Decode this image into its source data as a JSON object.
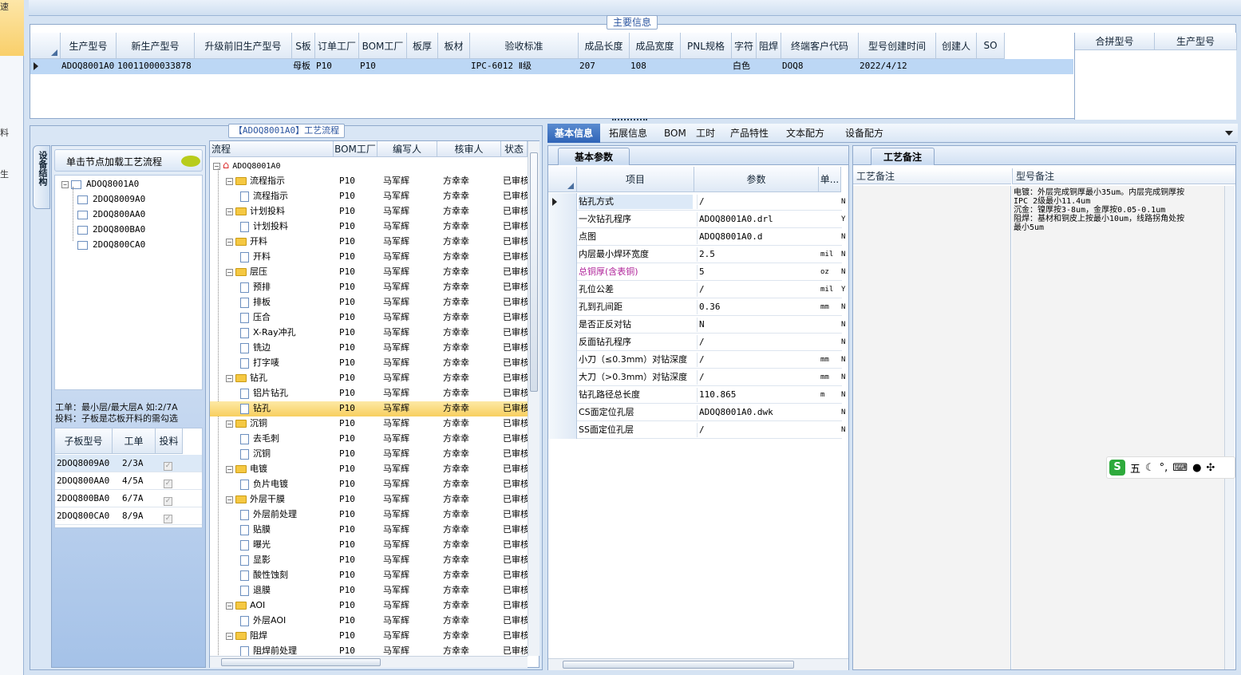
{
  "left_strip": {
    "items": [
      "速",
      "料",
      "生"
    ]
  },
  "main_info": {
    "caption": "主要信息",
    "columns": [
      "生产型号",
      "新生产型号",
      "升级前旧生产型号",
      "S板",
      "订单工厂",
      "BOM工厂",
      "板厚",
      "板材",
      "验收标准",
      "成品长度",
      "成品宽度",
      "PNL规格",
      "字符",
      "阻焊",
      "终端客户代码",
      "型号创建时间",
      "创建人",
      "SO"
    ],
    "row": [
      "ADOQ8001A0",
      "10011000033878",
      "",
      "母板",
      "P10",
      "P10",
      "",
      "",
      "IPC-6012 Ⅱ级",
      "207",
      "108",
      "",
      "白色",
      "",
      "DOQ8",
      "2022/4/12",
      "",
      ""
    ],
    "side_columns": [
      "合拼型号",
      "生产型号"
    ]
  },
  "process": {
    "caption": "【ADOQ8001A0】工艺流程",
    "vertical_tab": "设备结构",
    "load_button": "单击节点加载工艺流程",
    "struct_tree": {
      "root": "ADOQ8001A0",
      "children": [
        "2DOQ8009A0",
        "2DOQ800AA0",
        "2DOQ800BA0",
        "2DOQ800CA0"
      ]
    },
    "notes": [
      "工单：最小层/最大层A 如:2/7A",
      "投料：子板是芯板开料的需勾选"
    ],
    "sub_columns": [
      "子板型号",
      "工单",
      "投料"
    ],
    "sub_rows": [
      {
        "model": "2DOQ8009A0",
        "order": "2/3A",
        "feed": "✓"
      },
      {
        "model": "2DOQ800AA0",
        "order": "4/5A",
        "feed": "✓"
      },
      {
        "model": "2DOQ800BA0",
        "order": "6/7A",
        "feed": "✓"
      },
      {
        "model": "2DOQ800CA0",
        "order": "8/9A",
        "feed": "✓"
      }
    ],
    "flow_columns": [
      "流程",
      "BOM工厂",
      "编写人",
      "核审人",
      "状态"
    ],
    "flow_root": "ADOQ8001A0",
    "flow_rows": [
      {
        "level": 1,
        "type": "folder",
        "name": "流程指示",
        "f": "P10",
        "w": "马军辉",
        "r": "方幸幸",
        "s": "已审核"
      },
      {
        "level": 2,
        "type": "doc",
        "name": "流程指示",
        "f": "P10",
        "w": "马军辉",
        "r": "方幸幸",
        "s": "已审核"
      },
      {
        "level": 1,
        "type": "folder",
        "name": "计划投料",
        "f": "P10",
        "w": "马军辉",
        "r": "方幸幸",
        "s": "已审核"
      },
      {
        "level": 2,
        "type": "doc",
        "name": "计划投料",
        "f": "P10",
        "w": "马军辉",
        "r": "方幸幸",
        "s": "已审核"
      },
      {
        "level": 1,
        "type": "folder",
        "name": "开料",
        "f": "P10",
        "w": "马军辉",
        "r": "方幸幸",
        "s": "已审核"
      },
      {
        "level": 2,
        "type": "doc",
        "name": "开料",
        "f": "P10",
        "w": "马军辉",
        "r": "方幸幸",
        "s": "已审核"
      },
      {
        "level": 1,
        "type": "folder",
        "name": "层压",
        "f": "P10",
        "w": "马军辉",
        "r": "方幸幸",
        "s": "已审核"
      },
      {
        "level": 2,
        "type": "doc",
        "name": "预排",
        "f": "P10",
        "w": "马军辉",
        "r": "方幸幸",
        "s": "已审核"
      },
      {
        "level": 2,
        "type": "doc",
        "name": "排板",
        "f": "P10",
        "w": "马军辉",
        "r": "方幸幸",
        "s": "已审核"
      },
      {
        "level": 2,
        "type": "doc",
        "name": "压合",
        "f": "P10",
        "w": "马军辉",
        "r": "方幸幸",
        "s": "已审核"
      },
      {
        "level": 2,
        "type": "doc",
        "name": "X-Ray冲孔",
        "f": "P10",
        "w": "马军辉",
        "r": "方幸幸",
        "s": "已审核"
      },
      {
        "level": 2,
        "type": "doc",
        "name": "铣边",
        "f": "P10",
        "w": "马军辉",
        "r": "方幸幸",
        "s": "已审核"
      },
      {
        "level": 2,
        "type": "doc",
        "name": "打字唛",
        "f": "P10",
        "w": "马军辉",
        "r": "方幸幸",
        "s": "已审核"
      },
      {
        "level": 1,
        "type": "folder",
        "name": "钻孔",
        "f": "P10",
        "w": "马军辉",
        "r": "方幸幸",
        "s": "已审核"
      },
      {
        "level": 2,
        "type": "doc",
        "name": "铝片钻孔",
        "f": "P10",
        "w": "马军辉",
        "r": "方幸幸",
        "s": "已审核"
      },
      {
        "level": 2,
        "type": "doc",
        "name": "钻孔",
        "f": "P10",
        "w": "马军辉",
        "r": "方幸幸",
        "s": "已审核",
        "selected": true
      },
      {
        "level": 1,
        "type": "folder",
        "name": "沉铜",
        "f": "P10",
        "w": "马军辉",
        "r": "方幸幸",
        "s": "已审核"
      },
      {
        "level": 2,
        "type": "doc",
        "name": "去毛刺",
        "f": "P10",
        "w": "马军辉",
        "r": "方幸幸",
        "s": "已审核"
      },
      {
        "level": 2,
        "type": "doc",
        "name": "沉铜",
        "f": "P10",
        "w": "马军辉",
        "r": "方幸幸",
        "s": "已审核"
      },
      {
        "level": 1,
        "type": "folder",
        "name": "电镀",
        "f": "P10",
        "w": "马军辉",
        "r": "方幸幸",
        "s": "已审核"
      },
      {
        "level": 2,
        "type": "doc",
        "name": "负片电镀",
        "f": "P10",
        "w": "马军辉",
        "r": "方幸幸",
        "s": "已审核"
      },
      {
        "level": 1,
        "type": "folder",
        "name": "外层干膜",
        "f": "P10",
        "w": "马军辉",
        "r": "方幸幸",
        "s": "已审核"
      },
      {
        "level": 2,
        "type": "doc",
        "name": "外层前处理",
        "f": "P10",
        "w": "马军辉",
        "r": "方幸幸",
        "s": "已审核"
      },
      {
        "level": 2,
        "type": "doc",
        "name": "贴膜",
        "f": "P10",
        "w": "马军辉",
        "r": "方幸幸",
        "s": "已审核"
      },
      {
        "level": 2,
        "type": "doc",
        "name": "曝光",
        "f": "P10",
        "w": "马军辉",
        "r": "方幸幸",
        "s": "已审核"
      },
      {
        "level": 2,
        "type": "doc",
        "name": "显影",
        "f": "P10",
        "w": "马军辉",
        "r": "方幸幸",
        "s": "已审核"
      },
      {
        "level": 2,
        "type": "doc",
        "name": "酸性蚀刻",
        "f": "P10",
        "w": "马军辉",
        "r": "方幸幸",
        "s": "已审核"
      },
      {
        "level": 2,
        "type": "doc",
        "name": "退膜",
        "f": "P10",
        "w": "马军辉",
        "r": "方幸幸",
        "s": "已审核"
      },
      {
        "level": 1,
        "type": "folder",
        "name": "AOI",
        "f": "P10",
        "w": "马军辉",
        "r": "方幸幸",
        "s": "已审核"
      },
      {
        "level": 2,
        "type": "doc",
        "name": "外层AOI",
        "f": "P10",
        "w": "马军辉",
        "r": "方幸幸",
        "s": "已审核"
      },
      {
        "level": 1,
        "type": "folder",
        "name": "阻焊",
        "f": "P10",
        "w": "马军辉",
        "r": "方幸幸",
        "s": "已审核"
      },
      {
        "level": 2,
        "type": "doc",
        "name": "阻焊前处理",
        "f": "P10",
        "w": "马军辉",
        "r": "方幸幸",
        "s": "已审核"
      }
    ]
  },
  "tabs": [
    "基本信息",
    "拓展信息",
    "BOM",
    "工时",
    "产品特性",
    "文本配方",
    "设备配方"
  ],
  "basic": {
    "subtab": "基本参数",
    "columns": [
      "项目",
      "参数",
      "单..."
    ],
    "rows": [
      {
        "item": "钻孔方式",
        "param": "/",
        "unit": "",
        "flag": "N"
      },
      {
        "item": "一次钻孔程序",
        "param": "ADOQ8001A0.drl",
        "unit": "",
        "flag": "Y"
      },
      {
        "item": "点图",
        "param": "ADOQ8001A0.d",
        "unit": "",
        "flag": "N"
      },
      {
        "item": "内层最小焊环宽度",
        "param": "2.5",
        "unit": "mil",
        "flag": "N"
      },
      {
        "item": "总铜厚(含表铜)",
        "param": "5",
        "unit": "oz",
        "flag": "N",
        "highlight": true
      },
      {
        "item": "孔位公差",
        "param": "/",
        "unit": "mil",
        "flag": "Y"
      },
      {
        "item": "孔到孔间距",
        "param": "0.36",
        "unit": "mm",
        "flag": "N"
      },
      {
        "item": "是否正反对钻",
        "param": "N",
        "unit": "",
        "flag": "N"
      },
      {
        "item": "反面钻孔程序",
        "param": "/",
        "unit": "",
        "flag": "N"
      },
      {
        "item": "小刀（≤0.3mm）对钻深度",
        "param": "/",
        "unit": "mm",
        "flag": "N"
      },
      {
        "item": "大刀（>0.3mm）对钻深度",
        "param": "/",
        "unit": "mm",
        "flag": "N"
      },
      {
        "item": "钻孔路径总长度",
        "param": "110.865",
        "unit": "m",
        "flag": "N"
      },
      {
        "item": "CS面定位孔层",
        "param": "ADOQ8001A0.dwk",
        "unit": "",
        "flag": "N"
      },
      {
        "item": "SS面定位孔层",
        "param": "/",
        "unit": "",
        "flag": "N"
      }
    ]
  },
  "remarks": {
    "subtab": "工艺备注",
    "columns": [
      "工艺备注",
      "型号备注"
    ],
    "model_note": [
      "电镀：外层完成铜厚最小35um。内层完成铜厚按",
      "IPC 2级最小11.4um",
      "沉金：镍厚按3-8um，金厚按0.05-0.1um",
      "阻焊：基材和铜皮上按最小10um，线路拐角处按",
      "最小5um"
    ]
  },
  "ime": {
    "mode": "五"
  },
  "colors": {
    "selected_row": "#fbd56a",
    "tab_active": "#3a6fc0",
    "highlight_text": "#b0249a"
  }
}
